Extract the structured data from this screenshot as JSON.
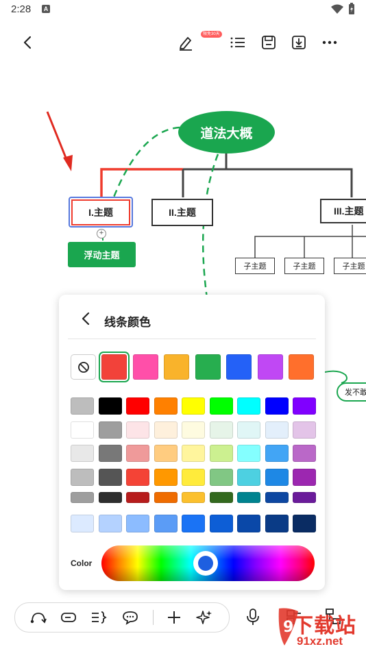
{
  "status_bar": {
    "time": "2:28",
    "notif_letter": "A"
  },
  "toolbar": {
    "badge": "限免30天"
  },
  "mindmap": {
    "root": "道法大概",
    "branches": [
      "I.主题",
      "II.主题",
      "III.主题"
    ],
    "subtopics": [
      "子主题",
      "子主题",
      "子主题"
    ],
    "floating": "浮动主题",
    "side_node": "发不敢"
  },
  "panel": {
    "title": "线条颜色",
    "color_label": "Color",
    "theme_colors": [
      "#f2423a",
      "#ff4fa9",
      "#f9b32b",
      "#27ae4f",
      "#2461f7",
      "#c048f4",
      "#ff6f2c"
    ],
    "selected_theme_color": "#f2423a",
    "palette_rows": [
      [
        "#bdbdbd",
        "#000000",
        "#ff0000",
        "#ff8000",
        "#ffff00",
        "#00ff00",
        "#00ffff",
        "#0000ff",
        "#8000ff"
      ],
      [
        "#ffffff",
        "#9e9e9e",
        "#fde4e7",
        "#fef0dc",
        "#fefbe0",
        "#e6f4e8",
        "#e0f6f6",
        "#e3effb",
        "#e3c4e8"
      ],
      [
        "#e8e8e8",
        "#787878",
        "#ef9a9a",
        "#ffcc80",
        "#fff59d",
        "#ccf090",
        "#84ffff",
        "#42a5f5",
        "#ba68c8"
      ],
      [
        "#bdbdbd",
        "#555555",
        "#f44336",
        "#ff9800",
        "#ffeb3b",
        "#81c784",
        "#4dd0e1",
        "#1e88e5",
        "#9c27b0"
      ],
      [
        "#9e9e9e",
        "#2e2e2e",
        "#b71c1c",
        "#ef6c00",
        "#fbc02d",
        "#33691e",
        "#00838f",
        "#0d47a1",
        "#6a1b9a"
      ]
    ],
    "blue_row": [
      "#dceaff",
      "#b4d2ff",
      "#8cbcff",
      "#5b9cf6",
      "#1a73f5",
      "#0d5ed6",
      "#0a48a8",
      "#0a3b86",
      "#0a2c63"
    ]
  },
  "watermark": {
    "text": "下载站",
    "url": "91xz.net"
  }
}
